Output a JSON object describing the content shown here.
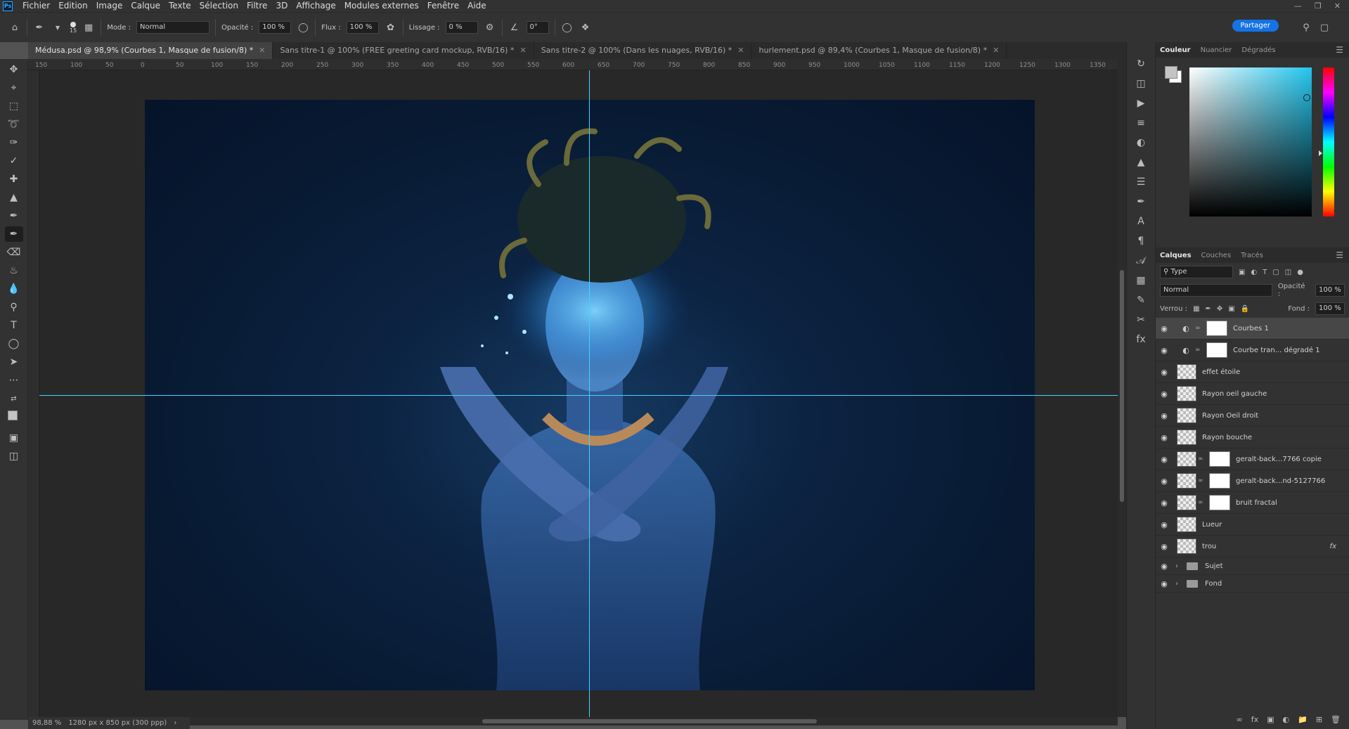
{
  "menu": [
    "Fichier",
    "Edition",
    "Image",
    "Calque",
    "Texte",
    "Sélection",
    "Filtre",
    "3D",
    "Affichage",
    "Modules externes",
    "Fenêtre",
    "Aide"
  ],
  "app_icon": "Ps",
  "options": {
    "brush_size": "15",
    "mode_label": "Mode :",
    "mode_value": "Normal",
    "opacity_label": "Opacité :",
    "opacity_value": "100 %",
    "flow_label": "Flux :",
    "flow_value": "100 %",
    "smoothing_label": "Lissage :",
    "smoothing_value": "0 %",
    "angle_value": "0°",
    "share_label": "Partager"
  },
  "tabs": [
    {
      "label": "Médusa.psd @ 98,9% (Courbes 1, Masque de fusion/8) *"
    },
    {
      "label": "Sans titre-1 @ 100% (FREE greeting card mockup, RVB/16) *"
    },
    {
      "label": "Sans titre-2 @ 100% (Dans les nuages, RVB/16) *"
    },
    {
      "label": "hurlement.psd @ 89,4% (Courbes 1, Masque de fusion/8) *"
    }
  ],
  "ruler_ticks": [
    "150",
    "100",
    "50",
    "0",
    "50",
    "100",
    "150",
    "200",
    "250",
    "300",
    "350",
    "400",
    "450",
    "500",
    "550",
    "600",
    "650",
    "700",
    "750",
    "800",
    "850",
    "900",
    "950",
    "1000",
    "1050",
    "1100",
    "1150",
    "1200",
    "1250",
    "1300",
    "1350"
  ],
  "status": {
    "zoom": "98,88 %",
    "doc_info": "1280 px x 850 px (300 ppp)"
  },
  "color_panel": {
    "tabs": [
      "Couleur",
      "Nuancier",
      "Dégradés"
    ],
    "hue_color": "#22c6ee"
  },
  "layers_panel": {
    "tabs": [
      "Calques",
      "Couches",
      "Tracés"
    ],
    "filter_label": "Type",
    "blend_mode": "Normal",
    "opacity_label": "Opacité :",
    "opacity_value": "100 %",
    "lock_label": "Verrou :",
    "fill_label": "Fond :",
    "fill_value": "100 %",
    "layers": [
      {
        "name": "Courbes 1",
        "kind": "adjustment",
        "selected": true
      },
      {
        "name": "Courbe tran... dégradé 1",
        "kind": "adjustment"
      },
      {
        "name": "effet étoile",
        "kind": "pixel"
      },
      {
        "name": "Rayon oeil gauche",
        "kind": "pixel"
      },
      {
        "name": "Rayon Oeil droit",
        "kind": "pixel"
      },
      {
        "name": "Rayon bouche",
        "kind": "pixel"
      },
      {
        "name": "geralt-back...7766 copie",
        "kind": "smart-mask"
      },
      {
        "name": "geralt-back...nd-5127766",
        "kind": "smart-mask"
      },
      {
        "name": "bruit fractal",
        "kind": "pixel-mask"
      },
      {
        "name": "Lueur",
        "kind": "pixel"
      },
      {
        "name": "trou",
        "kind": "pixel-fx",
        "fx": "fx"
      }
    ],
    "groups": [
      {
        "name": "Sujet"
      },
      {
        "name": "Fond"
      }
    ]
  }
}
